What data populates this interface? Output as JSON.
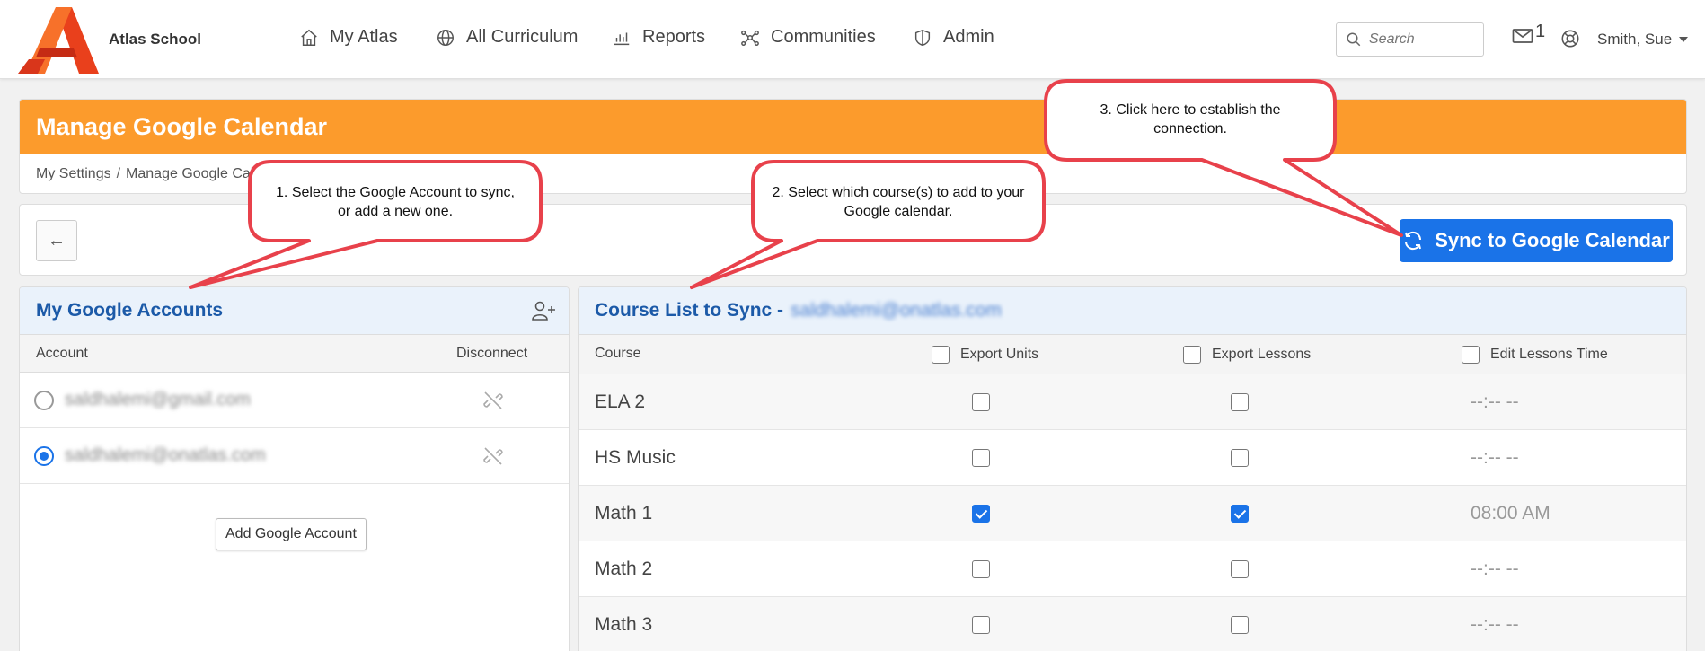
{
  "brand": {
    "school_name": "Atlas School"
  },
  "nav": {
    "items": [
      {
        "label": "My Atlas",
        "icon": "home-icon"
      },
      {
        "label": "All Curriculum",
        "icon": "globe-icon"
      },
      {
        "label": "Reports",
        "icon": "bar-chart-icon"
      },
      {
        "label": "Communities",
        "icon": "network-icon"
      },
      {
        "label": "Admin",
        "icon": "shield-icon"
      }
    ],
    "search_placeholder": "Search",
    "mail_count": "1",
    "user_name": "Smith, Sue"
  },
  "page": {
    "title": "Manage Google Calendar",
    "breadcrumb": [
      "My Settings",
      "/",
      "Manage Google Cal"
    ],
    "back_label": "←",
    "sync_button": "Sync to Google Calendar"
  },
  "accounts_panel": {
    "title": "My Google Accounts",
    "col_account": "Account",
    "col_disconnect": "Disconnect",
    "accounts": [
      {
        "email": "saldhalemi@gmail.com",
        "selected": false
      },
      {
        "email": "saldhalemi@onatlas.com",
        "selected": true
      }
    ],
    "add_button": "Add Google Account"
  },
  "courses_panel": {
    "title": "Course List to Sync -",
    "account_email": "saldhalemi@onatlas.com",
    "col_course": "Course",
    "col_units": "Export Units",
    "col_lessons": "Export Lessons",
    "col_time": "Edit Lessons Time",
    "courses": [
      {
        "name": "ELA 2",
        "units": false,
        "lessons": false,
        "time": "--:-- --"
      },
      {
        "name": "HS Music",
        "units": false,
        "lessons": false,
        "time": "--:-- --"
      },
      {
        "name": "Math 1",
        "units": true,
        "lessons": true,
        "time": "08:00 AM"
      },
      {
        "name": "Math 2",
        "units": false,
        "lessons": false,
        "time": "--:-- --"
      },
      {
        "name": "Math 3",
        "units": false,
        "lessons": false,
        "time": "--:-- --"
      }
    ]
  },
  "callouts": {
    "one": "1. Select the Google Account to sync, or add a new one.",
    "two": "2. Select which course(s) to add to your Google calendar.",
    "three": "3. Click here to establish the connection."
  },
  "colors": {
    "orange": "#fc9b2c",
    "blue": "#1a73e8",
    "panel_title": "#1c5aa8",
    "callout_border": "#e8414b"
  }
}
